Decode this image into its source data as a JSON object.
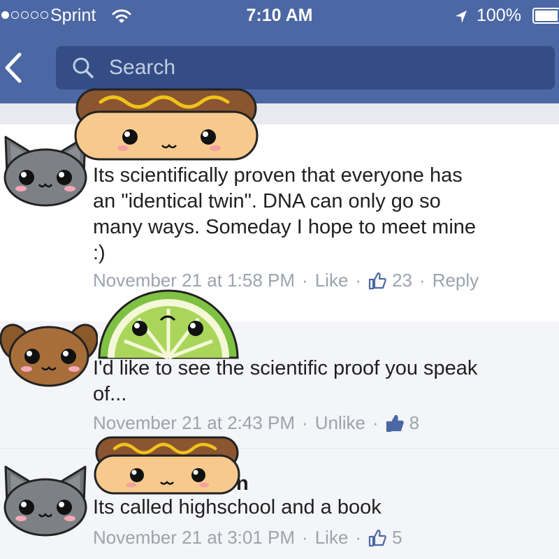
{
  "status_bar": {
    "carrier": "Sprint",
    "time": "7:10 AM",
    "battery": "100%",
    "signal_bars_filled": 1,
    "signal_bars_total": 5
  },
  "search": {
    "placeholder": "Search"
  },
  "icons": {
    "back": "chevron-left-icon",
    "search": "search-icon",
    "like": "thumbs-up-icon",
    "wifi": "wifi-icon",
    "location": "location-arrow-icon",
    "battery": "battery-icon"
  },
  "stickers": {
    "avatar_1": "gray-cat-face",
    "avatar_2": "brown-dog-face",
    "avatar_3": "gray-cat-face",
    "overlay_1": "hotdog-face",
    "overlay_2": "lime-slice-face",
    "overlay_3": "hotdog-face"
  },
  "colors": {
    "header": "#4b67a4",
    "search_box": "#344d85",
    "like_blue": "#4b67a4",
    "meta_gray": "#9da3ad"
  },
  "comments": [
    {
      "text_lines": [
        "Its scientifically proven that everyone has",
        "an \"identical twin\". DNA can only go so",
        "many ways. Someday I hope to meet mine",
        ":)"
      ],
      "timestamp": "November 21 at 1:58 PM",
      "action": "Like",
      "likes": "23",
      "reply": "Reply",
      "liked_by_viewer": false
    },
    {
      "text_lines": [
        "I'd like to see the scientific proof you speak",
        "of..."
      ],
      "timestamp": "November 21 at 2:43 PM",
      "action": "Unlike",
      "likes": "8",
      "liked_by_viewer": true
    },
    {
      "name_fragment": "n",
      "text_lines": [
        "Its called highschool and a book"
      ],
      "timestamp": "November 21 at 3:01 PM",
      "action": "Like",
      "likes": "5",
      "liked_by_viewer": false
    }
  ]
}
